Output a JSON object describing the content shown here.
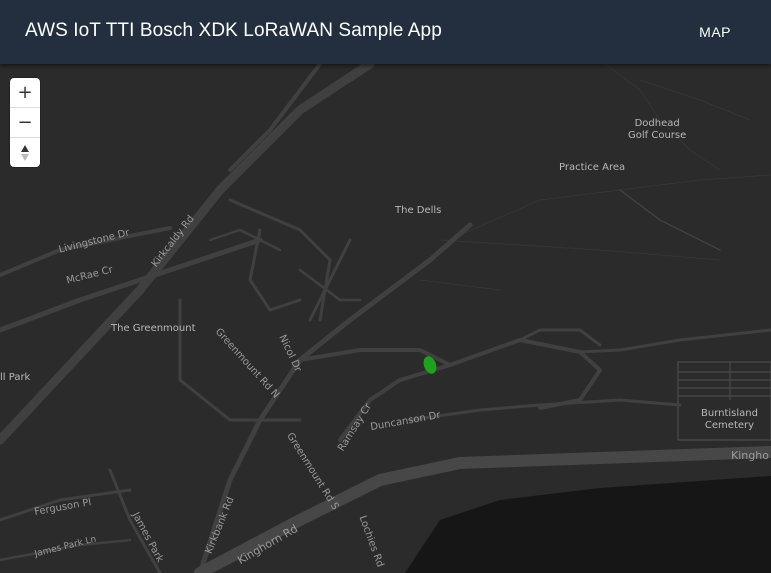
{
  "header": {
    "title": "AWS IoT TTI Bosch XDK LoRaWAN Sample App",
    "nav_map": "MAP"
  },
  "controls": {
    "zoom_in": "+",
    "zoom_out": "−",
    "compass": "▲"
  },
  "map": {
    "labels": {
      "dodhead": "Dodhead\nGolf Course",
      "practice": "Practice Area",
      "dells": "The Dells",
      "livingstone": "Livingstone Dr",
      "mcrae": "McRae Cr",
      "kirkcaldy": "Kirkcaldy Rd",
      "greenmount": "The Greenmount",
      "greenmount_rd_n": "Greenmount Rd N",
      "nicol": "Nicol Dr",
      "hill_park": "ll Park",
      "ramsay": "Ramsay Cr",
      "duncanson": "Duncanson Dr",
      "burntisland": "Burntisland\nCemetery",
      "kinghorn_right": "Kingho",
      "greenmount_rd_s": "Greenmount Rd S",
      "ferguson": "Ferguson Pl",
      "james_park": "James Park",
      "james_park_ln": "James Park Ln",
      "kirkbank": "Kirkbank Rd",
      "kinghorn_rd": "Kinghorn Rd",
      "lochies": "Lochies Rd"
    },
    "marker_color": "#1fa11f",
    "road_color": "#3e3e3e",
    "water_color": "#161616"
  }
}
